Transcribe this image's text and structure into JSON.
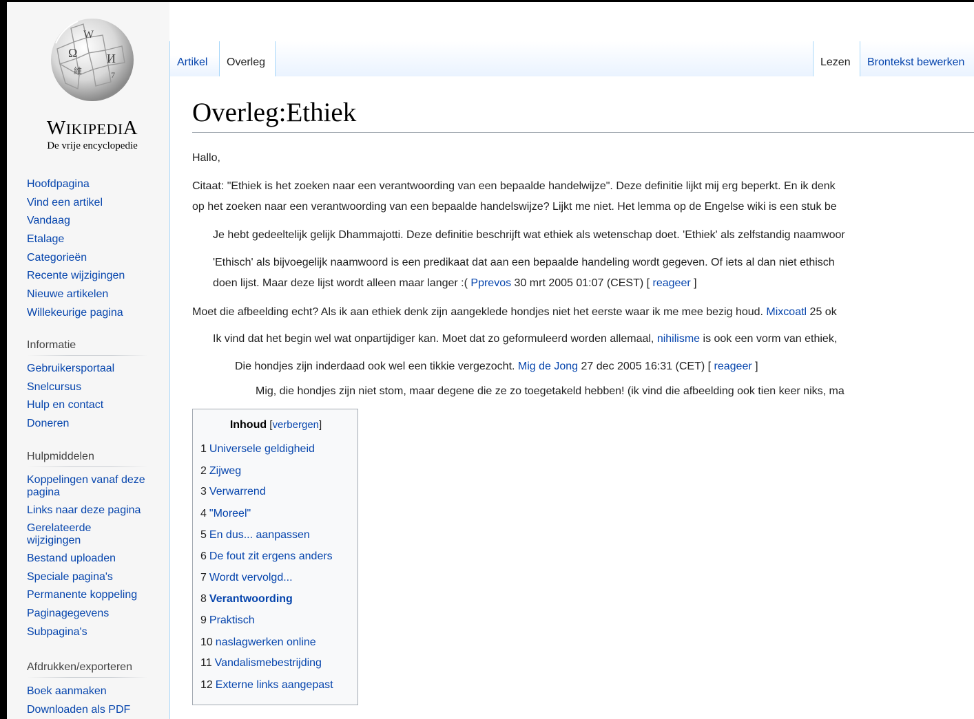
{
  "logo": {
    "wordmark_first": "W",
    "wordmark_rest": "IKIPEDI",
    "wordmark_last": "A",
    "tagline": "De vrije encyclopedie"
  },
  "nav_main": [
    "Hoofdpagina",
    "Vind een artikel",
    "Vandaag",
    "Etalage",
    "Categorieën",
    "Recente wijzigingen",
    "Nieuwe artikelen",
    "Willekeurige pagina"
  ],
  "informatie": {
    "heading": "Informatie",
    "items": [
      "Gebruikersportaal",
      "Snelcursus",
      "Hulp en contact",
      "Doneren"
    ]
  },
  "hulpmiddelen": {
    "heading": "Hulpmiddelen",
    "items": [
      "Koppelingen vanaf deze pagina",
      "Links naar deze pagina",
      "Gerelateerde wijzigingen",
      "Bestand uploaden",
      "Speciale pagina's",
      "Permanente koppeling",
      "Paginagegevens",
      "Subpagina's"
    ]
  },
  "afdrukken": {
    "heading": "Afdrukken/exporteren",
    "items": [
      "Boek aanmaken",
      "Downloaden als PDF"
    ]
  },
  "tabs": {
    "artikel": "Artikel",
    "overleg": "Overleg",
    "lezen": "Lezen",
    "bewerken": "Brontekst bewerken"
  },
  "page_title": "Overleg:Ethiek",
  "body": {
    "greeting": "Hallo,",
    "p1_line1": "Citaat: \"Ethiek is het zoeken naar een verantwoording van een bepaalde handelwijze\". Deze definitie lijkt mij erg beperkt. En ik denk",
    "p1_line2": "op het zoeken naar een verantwoording van een bepaalde handelswijze? Lijkt me niet. Het lemma op de Engelse wiki is een stuk be",
    "p2": "Je hebt gedeeltelijk gelijk Dhammajotti. Deze definitie beschrijft wat ethiek als wetenschap doet. 'Ethiek' als zelfstandig naamwoor",
    "p3_line1": "'Ethisch' als bijvoegelijk naamwoord is een predikaat dat aan een bepaalde handeling wordt gegeven. Of iets al dan niet ethisch",
    "p3_line2_pre": "doen lijst. Maar deze lijst wordt alleen maar langer :( ",
    "p3_user": "Pprevos",
    "p3_date": " 30 mrt 2005 01:07 (CEST)  [ ",
    "p3_reply": "reageer",
    "p3_end": " ]",
    "p4_pre": "Moet die afbeelding echt? Als ik aan ethiek denk zijn aangeklede hondjes niet het eerste waar ik me mee bezig houd. ",
    "p4_user": "Mixcoatl",
    "p4_post": " 25 ok",
    "p5_pre": "Ik vind dat het begin wel wat onpartijdiger kan. Moet dat zo geformuleerd worden allemaal, ",
    "p5_link": "nihilisme",
    "p5_post": " is ook een vorm van ethiek, ",
    "p6_pre": "Die hondjes zijn inderdaad ook wel een tikkie vergezocht. ",
    "p6_user": "Mig de Jong",
    "p6_date": " 27 dec 2005 16:31 (CET)  [ ",
    "p6_reply": "reageer",
    "p6_end": " ]",
    "p7": "Mig, die hondjes zijn niet stom, maar degene die ze zo toegetakeld hebben! (ik vind die afbeelding ook tien keer niks, ma"
  },
  "toc": {
    "title": "Inhoud",
    "toggle_open": " [",
    "toggle": "verbergen",
    "toggle_close": "]",
    "items": [
      {
        "num": "1",
        "text": "Universele geldigheid"
      },
      {
        "num": "2",
        "text": "Zijweg"
      },
      {
        "num": "3",
        "text": "Verwarrend"
      },
      {
        "num": "4",
        "text": "\"Moreel\""
      },
      {
        "num": "5",
        "text": "En dus... aanpassen"
      },
      {
        "num": "6",
        "text": "De fout zit ergens anders"
      },
      {
        "num": "7",
        "text": "Wordt vervolgd..."
      },
      {
        "num": "8",
        "text": "Verantwoording"
      },
      {
        "num": "9",
        "text": "Praktisch"
      },
      {
        "num": "10",
        "text": "naslagwerken online"
      },
      {
        "num": "11",
        "text": "Vandalismebestrijding"
      },
      {
        "num": "12",
        "text": "Externe links aangepast"
      }
    ]
  }
}
